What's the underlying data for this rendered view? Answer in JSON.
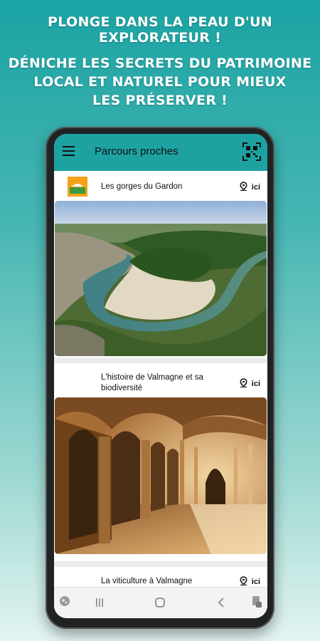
{
  "promo": {
    "line1": "PLONGE DANS LA PEAU D'UN EXPLORATEUR !",
    "line2": "DÉNICHE LES SECRETS DU PATRIMOINE",
    "line3": "LOCAL ET NATUREL POUR MIEUX",
    "line4": "LES PRÉSERVER !"
  },
  "appbar": {
    "title": "Parcours proches",
    "menu_icon": "hamburger-menu-icon",
    "qr_icon": "qr-scan-icon",
    "color": "#1da2a1"
  },
  "cards": [
    {
      "title": "Les gorges du Gardon",
      "location": "ici"
    },
    {
      "title_line1": "L'histoire de Valmagne et sa",
      "title_line2": "biodiversité",
      "location": "ici"
    },
    {
      "title": "La viticulture à Valmagne",
      "location": "ici"
    }
  ],
  "navbar": {
    "icons": [
      "assistant-icon",
      "recent-apps-icon",
      "home-icon",
      "back-icon",
      "screenshot-icon"
    ]
  }
}
